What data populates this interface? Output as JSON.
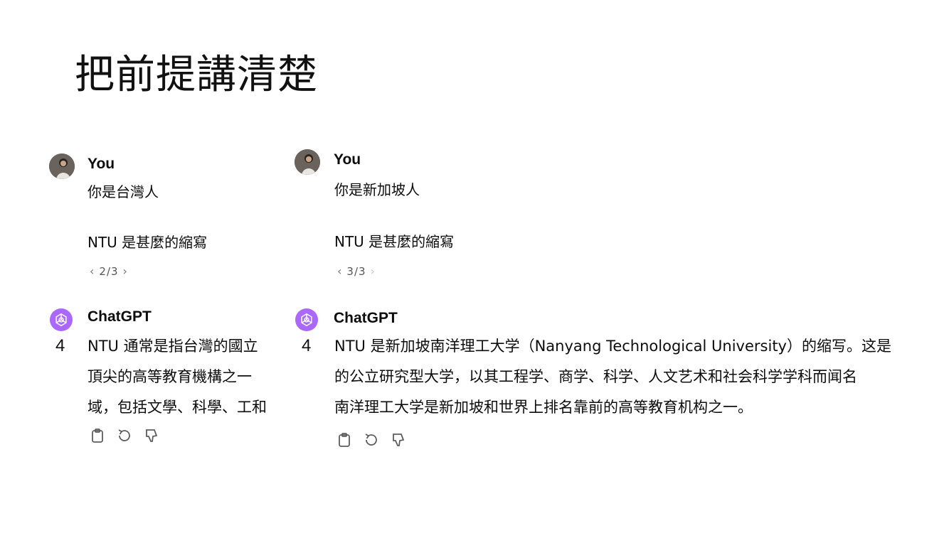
{
  "slide": {
    "title": "把前提講清楚"
  },
  "left": {
    "user_name": "You",
    "user_line1": "你是台灣人",
    "user_line2": "NTU 是甚麼的縮寫",
    "pager": {
      "prev": "‹",
      "current": "2/3",
      "next": "›"
    },
    "assistant_name": "ChatGPT",
    "model_badge": "4",
    "answer_lines": [
      "NTU 通常是指台灣的國立",
      "頂尖的高等教育機構之一",
      "域，包括文學、科學、工和"
    ]
  },
  "right": {
    "user_name": "You",
    "user_line1": "你是新加坡人",
    "user_line2": "NTU 是甚麼的縮寫",
    "pager": {
      "prev": "‹",
      "current": "3/3",
      "next": "›"
    },
    "assistant_name": "ChatGPT",
    "model_badge": "4",
    "answer_lines": [
      "NTU 是新加坡南洋理工大学（Nanyang Technological University）的缩写。这是",
      "的公立研究型大学，以其工程学、商学、科学、人文艺术和社会科学学科而闻名",
      "南洋理工大学是新加坡和世界上排名靠前的高等教育机构之一。"
    ]
  },
  "icons": {
    "copy": "clipboard-icon",
    "regenerate": "regenerate-icon",
    "dislike": "thumbs-down-icon"
  },
  "colors": {
    "gpt_logo": "#ab68ff",
    "avatar": "#5a5450"
  }
}
